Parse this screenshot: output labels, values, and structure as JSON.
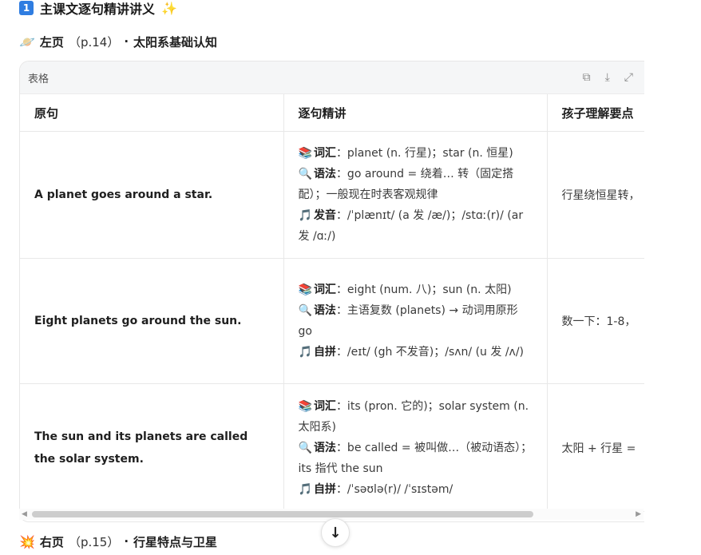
{
  "heading": {
    "number": "1",
    "title": "主课文逐句精讲讲义",
    "emoji": "✨"
  },
  "section_left": {
    "icon": "🪐",
    "title": "左页",
    "page": "（p.14）",
    "subtitle": "太阳系基础认知"
  },
  "table_card": {
    "label": "表格",
    "tools": {
      "copy": "⧉",
      "download": "⤓",
      "expand": "⤢"
    },
    "columns": [
      "原句",
      "逐句精讲",
      "孩子理解要点"
    ],
    "rows": [
      {
        "original": "A planet goes around a star.",
        "lines": [
          {
            "icon": "📚",
            "label": "词汇",
            "text": "：planet (n. 行星)；star (n. 恒星)"
          },
          {
            "icon": "🔍",
            "label": "语法",
            "text": "：go around = 绕着… 转（固定搭配）；一般现在时表客观规律"
          },
          {
            "icon": "🎵",
            "label": "发音",
            "text": "：/ˈplænɪt/ (a 发 /æ/)；/stɑː(r)/ (ar 发 /ɑː/)"
          }
        ],
        "kid": "行星绕恒星转，"
      },
      {
        "original": "Eight planets go around the sun.",
        "lines": [
          {
            "icon": "📚",
            "label": "词汇",
            "text": "：eight (num. 八)；sun (n. 太阳)"
          },
          {
            "icon": "🔍",
            "label": "语法",
            "text": "：主语复数 (planets) → 动词用原形 go"
          },
          {
            "icon": "🎵",
            "label": "自拼",
            "text": "：/eɪt/ (gh 不发音)；/sʌn/ (u 发 /ʌ/)"
          }
        ],
        "kid": "数一下：1-8，"
      },
      {
        "original": "The sun and its planets are called the solar system.",
        "lines": [
          {
            "icon": "📚",
            "label": "词汇",
            "text": "：its (pron. 它的)；solar system (n. 太阳系)"
          },
          {
            "icon": "🔍",
            "label": "语法",
            "text": "：be called = 被叫做…（被动语态）；its 指代 the sun"
          },
          {
            "icon": "🎵",
            "label": "自拼",
            "text": "：/ˈsəʊlə(r)/ /ˈsɪstəm/"
          }
        ],
        "kid": "太阳 + 行星 ="
      }
    ]
  },
  "scroll_down": "↓",
  "section_right": {
    "icon": "💥",
    "title": "右页",
    "page": "（p.15）",
    "subtitle": "行星特点与卫星"
  }
}
